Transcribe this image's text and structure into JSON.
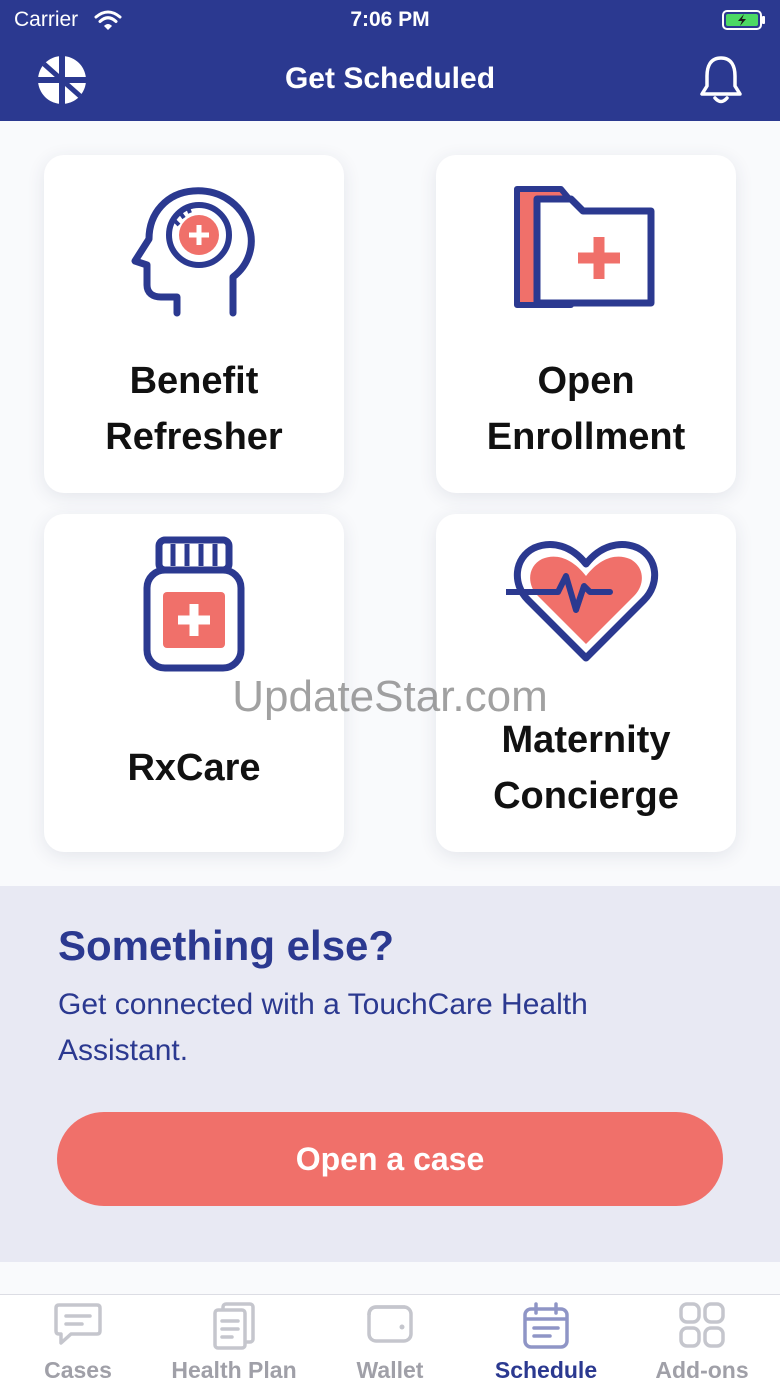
{
  "status_bar": {
    "carrier": "Carrier",
    "time": "7:06 PM"
  },
  "nav": {
    "title": "Get Scheduled"
  },
  "tiles": [
    {
      "line1": "Benefit",
      "line2": "Refresher",
      "icon": "head-plus-icon"
    },
    {
      "line1": "Open",
      "line2": "Enrollment",
      "icon": "medical-folder-icon"
    },
    {
      "line1": "RxCare",
      "icon": "pill-bottle-icon"
    },
    {
      "line1": "Maternity",
      "line2": "Concierge",
      "icon": "heartbeat-icon"
    }
  ],
  "watermark": "UpdateStar.com",
  "help": {
    "heading": "Something else?",
    "description": "Get connected with a TouchCare Health Assistant.",
    "button_label": "Open a case"
  },
  "tabs": [
    {
      "label": "Cases",
      "icon": "message-icon",
      "active": false
    },
    {
      "label": "Health Plan",
      "icon": "document-icon",
      "active": false
    },
    {
      "label": "Wallet",
      "icon": "wallet-icon",
      "active": false
    },
    {
      "label": "Schedule",
      "icon": "calendar-icon",
      "active": true
    },
    {
      "label": "Add-ons",
      "icon": "grid-icon",
      "active": false
    }
  ],
  "colors": {
    "brand": "#2b3990",
    "accent": "#f0706a",
    "tab_inactive": "#a0a0a8"
  }
}
